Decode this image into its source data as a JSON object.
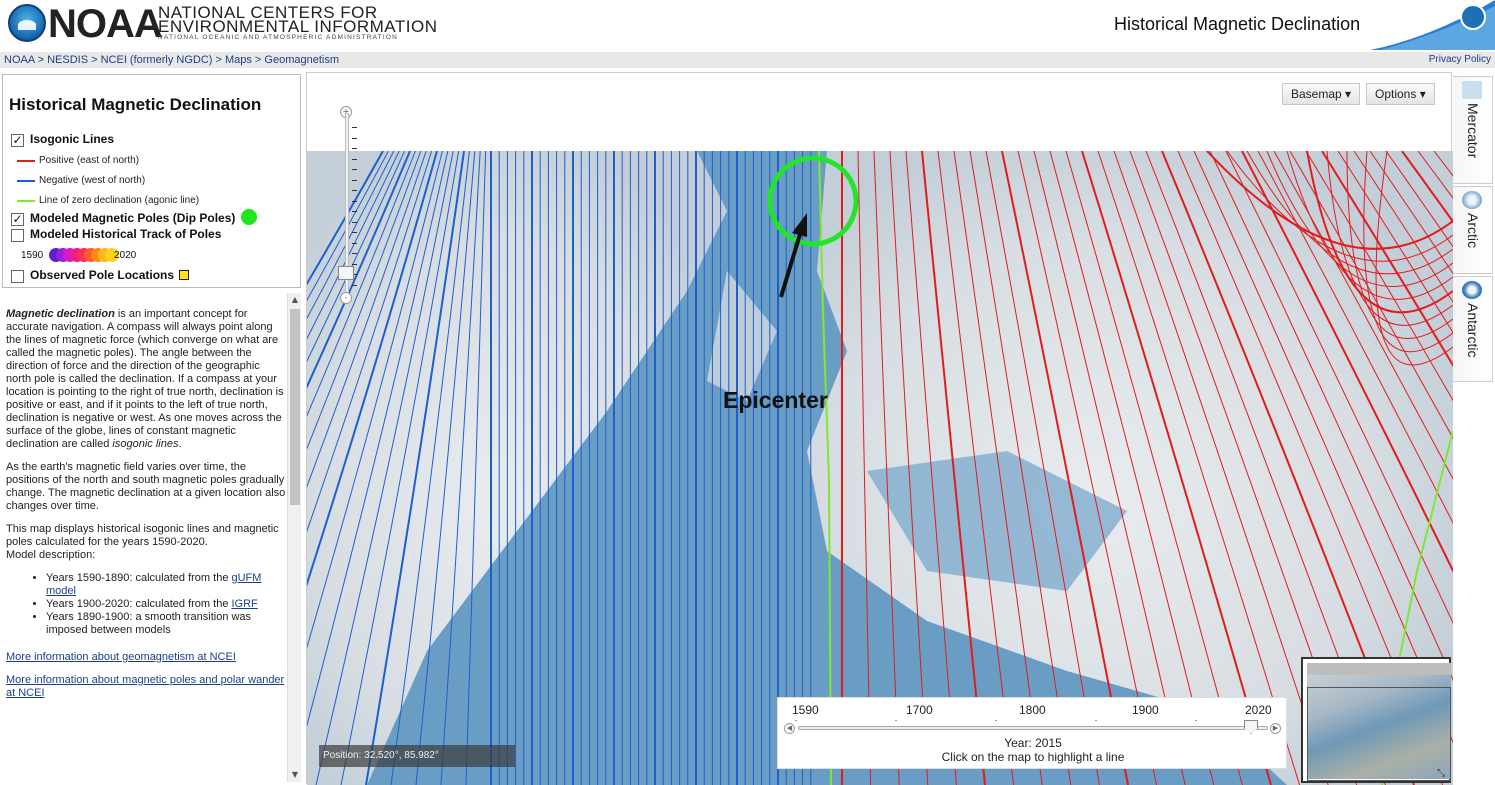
{
  "header": {
    "logo_word": "NOAA",
    "org_line1": "NATIONAL CENTERS FOR",
    "org_line2": "ENVIRONMENTAL INFORMATION",
    "org_line3": "NATIONAL OCEANIC AND ATMOSPHERIC ADMINISTRATION",
    "page_title": "Historical Magnetic Declination"
  },
  "breadcrumb": {
    "text": "NOAA > NESDIS > NCEI (formerly NGDC) > Maps > Geomagnetism",
    "privacy": "Privacy Policy"
  },
  "legend": {
    "title": "Historical Magnetic Declination",
    "isogonic_label": "Isogonic Lines",
    "isogonic_checked": true,
    "positive_label": "Positive (east of north)",
    "negative_label": "Negative (west of north)",
    "zero_label": "Line of zero declination (agonic line)",
    "poles_label": "Modeled Magnetic Poles (Dip Poles)",
    "poles_checked": true,
    "track_label": "Modeled Historical Track of Poles",
    "track_checked": false,
    "track_start": "1590",
    "track_end": "2020",
    "observed_label": "Observed Pole Locations",
    "observed_checked": false,
    "colors": {
      "positive": "#e21b1b",
      "negative": "#1b5fd1",
      "zero": "#7ee832",
      "dip_pole": "#1ee51e",
      "observed": "#ffe617"
    },
    "check_mark": "✓"
  },
  "description": {
    "p1_em": "Magnetic declination",
    "p1_rest": " is an important concept for accurate navigation. A compass will always point along the lines of magnetic force (which converge on what are called the magnetic poles). The angle between the direction of force and the direction of the geographic north pole is called the declination. If a compass at your location is pointing to the right of true north, declination is positive or east, and if it points to the left of true north, declination is negative or west. As one moves across the surface of the globe, lines of constant magnetic declination are called ",
    "p1_em2": "isogonic lines",
    "p1_end": ".",
    "p2": "As the earth's magnetic field varies over time, the positions of the north and south magnetic poles gradually change. The magnetic declination at a given location also changes over time.",
    "p3": "This map displays historical isogonic lines and magnetic poles calculated for the years 1590-2020.",
    "model_heading": "Model description:",
    "li1_text": "Years 1590-1890: calculated from the ",
    "li1_link": "gUFM model",
    "li2_text": "Years 1900-2020: calculated from the ",
    "li2_link": "IGRF",
    "li3_text": "Years 1890-1900: a smooth transition was imposed between models",
    "link_geomag": "More information about geomagnetism at NCEI",
    "link_poles": "More information about magnetic poles and polar wander at NCEI"
  },
  "map": {
    "basemap_button": "Basemap ▾",
    "options_button": "Options ▾",
    "epicenter_label": "Epicenter",
    "position_text": "Position: 32.520°, 85.982°",
    "zoom_in": "+",
    "zoom_out": "-",
    "colors": {
      "ocean": "#6a9dc4",
      "land": "#d8dde1",
      "negative_line": "#1b5fd1",
      "positive_line": "#e21b1b",
      "agonic_line": "#7ee832",
      "circle": "#22e52b",
      "arrow": "#111111"
    }
  },
  "time_slider": {
    "ticks": [
      "1590",
      "1700",
      "1800",
      "1900",
      "2020"
    ],
    "year_label": "Year: 2015",
    "hint": "Click on the map to highlight a line",
    "left_arrow": "◀",
    "right_arrow": "▶"
  },
  "side_tabs": [
    {
      "label": "Mercator"
    },
    {
      "label": "Arctic"
    },
    {
      "label": "Antarctic"
    }
  ],
  "overview": {
    "resize_glyph": "⤡"
  }
}
